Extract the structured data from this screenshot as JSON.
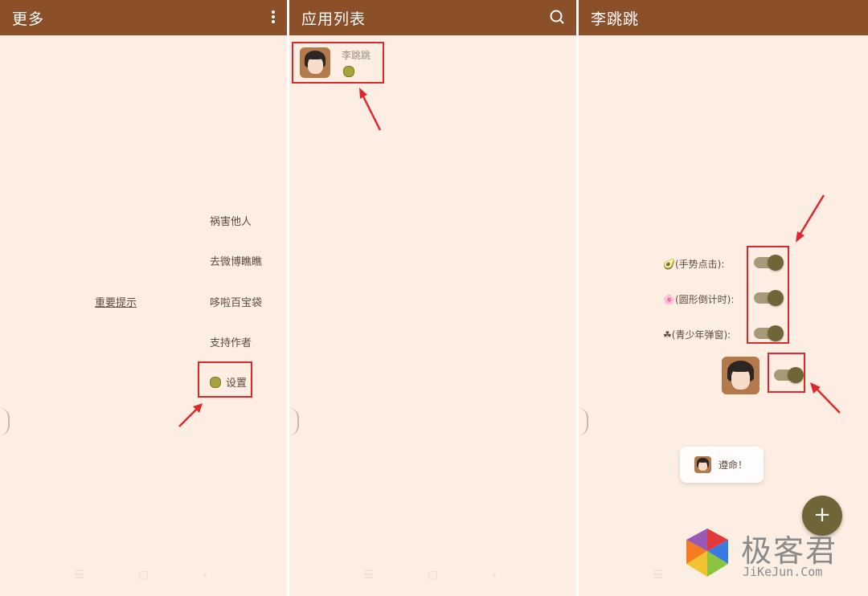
{
  "panel1": {
    "title": "更多",
    "menu": [
      "祸害他人",
      "去微博瞧瞧",
      "哆啦百宝袋",
      "支持作者"
    ],
    "settings_label": "设置",
    "important_notice": "重要提示"
  },
  "panel2": {
    "title": "应用列表",
    "app": {
      "name": "李跳跳"
    }
  },
  "panel3": {
    "title": "李跳跳",
    "toggles": [
      {
        "label": "(手势点击):",
        "emoji": "🥑",
        "on": true
      },
      {
        "label": "(圆形倒计时):",
        "emoji": "🌸",
        "on": true
      },
      {
        "label": "(青少年弹窗):",
        "emoji": "☘",
        "on": true
      }
    ],
    "master_toggle_on": true,
    "toast": "遵命！",
    "fab": "+"
  },
  "watermark": {
    "cn": "极客君",
    "en": "JiKeJun.Com"
  },
  "colors": {
    "appbar": "#8b4f2a",
    "background": "#fdeee4",
    "accent": "#6e6637",
    "highlight": "#e0282c"
  }
}
